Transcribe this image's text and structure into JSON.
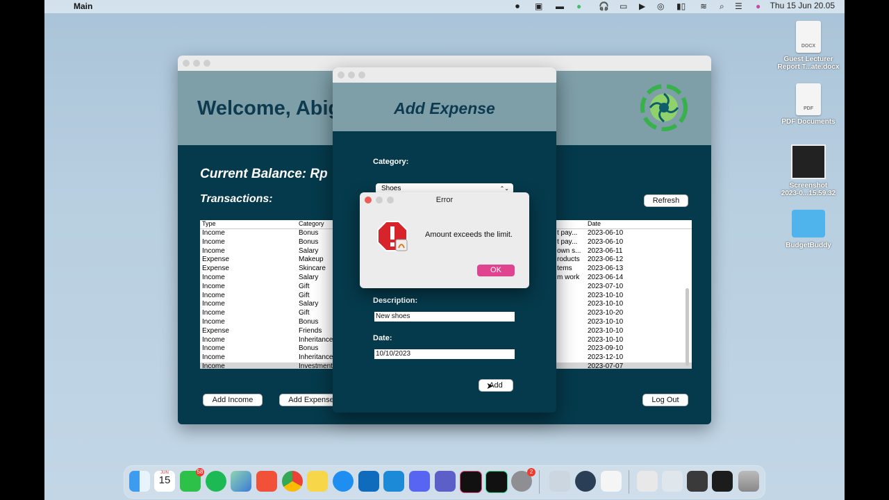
{
  "menubar": {
    "app_name": "Main",
    "clock": "Thu 15 Jun  20.05"
  },
  "desktop": {
    "icons": [
      {
        "label1": "Guest Lecturer",
        "label2": "Report T...ate.docx",
        "badge": "DOCX"
      },
      {
        "label1": "PDF Documents",
        "label2": "",
        "badge": "PDF"
      },
      {
        "label1": "Screenshot",
        "label2": "2023-0...15.59.32",
        "badge": ""
      },
      {
        "label1": "BudgetBuddy",
        "label2": "",
        "badge": ""
      }
    ]
  },
  "main_window": {
    "welcome": "Welcome, Abig",
    "balance": "Current Balance:  Rp",
    "transactions_title": "Transactions:",
    "refresh": "Refresh",
    "add_income": "Add Income",
    "add_expense": "Add Expense",
    "log_out": "Log Out",
    "columns": [
      "Type",
      "Category",
      "Date"
    ],
    "rows": [
      {
        "type": "Income",
        "category": "Bonus",
        "desc": "t pay...",
        "date": "2023-06-10"
      },
      {
        "type": "Income",
        "category": "Bonus",
        "desc": "t pay...",
        "date": "2023-06-10"
      },
      {
        "type": "Income",
        "category": "Salary",
        "desc": "own s...",
        "date": "2023-06-11"
      },
      {
        "type": "Expense",
        "category": "Makeup",
        "desc": "roducts",
        "date": "2023-06-12"
      },
      {
        "type": "Expense",
        "category": "Skincare",
        "desc": "tems",
        "date": "2023-06-13"
      },
      {
        "type": "Income",
        "category": "Salary",
        "desc": "m work",
        "date": "2023-06-14"
      },
      {
        "type": "Income",
        "category": "Gift",
        "desc": "",
        "date": "2023-07-10"
      },
      {
        "type": "Income",
        "category": "Gift",
        "desc": "",
        "date": "2023-10-10"
      },
      {
        "type": "Income",
        "category": "Salary",
        "desc": "",
        "date": "2023-10-10"
      },
      {
        "type": "Income",
        "category": "Gift",
        "desc": "",
        "date": "2023-10-20"
      },
      {
        "type": "Income",
        "category": "Bonus",
        "desc": "",
        "date": "2023-10-10"
      },
      {
        "type": "Expense",
        "category": "Friends",
        "desc": "",
        "date": "2023-10-10"
      },
      {
        "type": "Income",
        "category": "Inheritance",
        "desc": "",
        "date": "2023-10-10"
      },
      {
        "type": "Income",
        "category": "Bonus",
        "desc": "",
        "date": "2023-09-10"
      },
      {
        "type": "Income",
        "category": "Inheritance",
        "desc": "",
        "date": "2023-12-10"
      },
      {
        "type": "Income",
        "category": "Investment",
        "desc": "",
        "date": "2023-07-07"
      }
    ]
  },
  "expense_window": {
    "title": "Add Expense",
    "category_label": "Category:",
    "category_value": "Shoes",
    "description_label": "Description:",
    "description_value": "New shoes",
    "date_label": "Date:",
    "date_value": "10/10/2023",
    "add_button": "Add"
  },
  "error_dialog": {
    "title": "Error",
    "message": "Amount exceeds the limit.",
    "ok": "OK"
  },
  "dock": {
    "calendar_month": "JUN",
    "calendar_day": "15",
    "line_badge": "58",
    "settings_badge": "2"
  }
}
